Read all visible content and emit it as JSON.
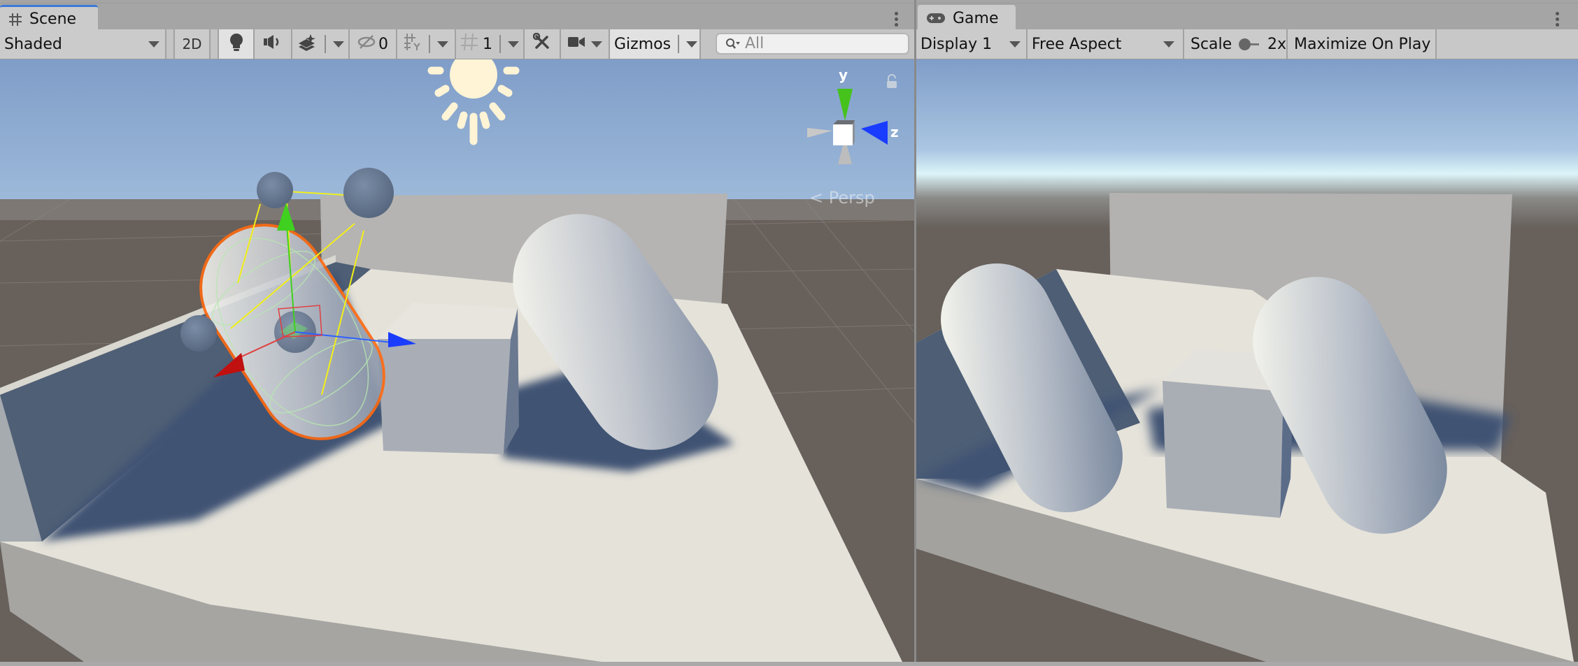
{
  "scene": {
    "tab_label": "Scene",
    "tab_icon": "grid-hash-icon",
    "draw_mode": "Shaded",
    "toggle_2d": "2D",
    "lighting_on": true,
    "hidden_count": "0",
    "grid_value": "1",
    "gizmos_label": "Gizmos",
    "search_placeholder": "All",
    "projection_label": "< Persp",
    "orientation_gizmo": {
      "y_label": "y",
      "z_label": "z"
    }
  },
  "game": {
    "tab_label": "Game",
    "tab_icon": "gamepad-icon",
    "display": "Display 1",
    "aspect": "Free Aspect",
    "scale_label": "Scale",
    "scale_value": "2x",
    "scale_fraction": 0.0,
    "maximize_label": "Maximize On Play"
  },
  "colors": {
    "selection_outline": "#ff6a10",
    "axis_x": "#c01010",
    "axis_y": "#40d020",
    "axis_z": "#1a3cff",
    "collider_lines": "#ffff00",
    "sky_top": "#7f9fca",
    "ground": "#67605b",
    "active_tab_accent": "#3a79d7"
  }
}
